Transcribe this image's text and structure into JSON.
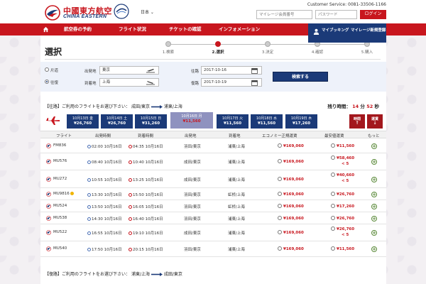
{
  "header": {
    "logo_cn": "中國東方航空",
    "logo_en": "CHINA EASTERN",
    "language": "日本 ⌄",
    "service": "Customer Service: 0081-33506-1166",
    "member_placeholder": "マイレージ会員番号",
    "password_placeholder": "パスワード",
    "login_label": "ログイン"
  },
  "nav": {
    "items": [
      "航空券の予約",
      "フライト状況",
      "チケットの確認",
      "インフォメーション"
    ],
    "mybooking": "マイブッキング",
    "mileage_signup": "マイレージ新規登録"
  },
  "page": {
    "title": "選択",
    "steps": [
      "1.検索",
      "2.選択",
      "3.決定",
      "4.確認",
      "5.購入"
    ],
    "active_step": 1
  },
  "search": {
    "oneway_label": "片道",
    "roundtrip_label": "往復",
    "depart_label": "出発地",
    "depart_value": "東京",
    "arrive_label": "到着地",
    "arrive_value": "上海",
    "outbound_label": "往路",
    "outbound_date": "2017-10-16",
    "return_label": "復路",
    "return_date": "2017-10-19",
    "search_label": "検索する"
  },
  "outbound": {
    "prefix": "【往路】ご利用のフライトをお選び下さい：",
    "from": "成田/東京",
    "to": "浦東/上海",
    "remaining_label": "残り時間：",
    "remaining_min": "14",
    "min_unit": "分",
    "remaining_sec": "52",
    "sec_unit": "秒"
  },
  "date_tabs": [
    {
      "date": "10月13日 金",
      "price": "¥26,760",
      "selected": false
    },
    {
      "date": "10月14日 土",
      "price": "¥26,760",
      "selected": false
    },
    {
      "date": "10月15日 日",
      "price": "¥31,260",
      "selected": false
    },
    {
      "date": "10月16日 月",
      "price": "¥11,560",
      "selected": true
    },
    {
      "date": "10月17日 火",
      "price": "¥11,560",
      "selected": false
    },
    {
      "date": "10月18日 水",
      "price": "¥11,560",
      "selected": false
    },
    {
      "date": "10月19日 木",
      "price": "¥17,260",
      "selected": false
    }
  ],
  "sort": [
    {
      "label": "時間",
      "arrow": "↑"
    },
    {
      "label": "運賃",
      "arrow": "↓"
    }
  ],
  "table": {
    "headers": [
      "フライト",
      "出発時間",
      "到着時間",
      "出発地",
      "到着地",
      "エコノミー正規運賃",
      "最安値運賃",
      "もっと"
    ],
    "rows": [
      {
        "flight": "FM836",
        "dep": "02:00 10月16日",
        "arr": "04:35 10月16日",
        "from": "羽田/東京",
        "to": "浦東/上海",
        "fare": "¥169,060",
        "low": "¥11,560",
        "low_sub": ""
      },
      {
        "flight": "MU576",
        "dep": "08:40 10月16日",
        "arr": "10:40 10月16日",
        "from": "成田/東京",
        "to": "浦東/上海",
        "fare": "¥169,060",
        "low": "¥58,460",
        "low_sub": "< 5"
      },
      {
        "flight": "MU272",
        "dep": "10:55 10月16日",
        "arr": "13:25 10月16日",
        "from": "成田/東京",
        "to": "浦東/上海",
        "fare": "¥169,060",
        "low": "¥40,660",
        "low_sub": "< 5"
      },
      {
        "flight": "MU9816",
        "dep": "13:30 10月16日",
        "arr": "15:50 10月16日",
        "from": "羽田/東京",
        "to": "虹桥/上海",
        "fare": "¥169,060",
        "low": "¥26,760",
        "low_sub": "",
        "coin": true
      },
      {
        "flight": "MU524",
        "dep": "13:50 10月16日",
        "arr": "16:05 10月16日",
        "from": "羽田/東京",
        "to": "虹桥/上海",
        "fare": "¥169,060",
        "low": "¥17,260",
        "low_sub": ""
      },
      {
        "flight": "MU538",
        "dep": "14:30 10月16日",
        "arr": "16:40 10月16日",
        "from": "羽田/東京",
        "to": "浦東/上海",
        "fare": "¥169,060",
        "low": "¥26,760",
        "low_sub": ""
      },
      {
        "flight": "MU522",
        "dep": "16:55 10月16日",
        "arr": "19:10 10月16日",
        "from": "成田/東京",
        "to": "浦東/上海",
        "fare": "¥169,060",
        "low": "¥26,760",
        "low_sub": "< 5"
      },
      {
        "flight": "MU540",
        "dep": "17:50 10月16日",
        "arr": "20:15 10月16日",
        "from": "羽田/東京",
        "to": "浦東/上海",
        "fare": "¥169,060",
        "low": "¥11,560",
        "low_sub": ""
      }
    ]
  },
  "return_section": {
    "prefix": "【復路】ご利用のフライトをお選び下さい：",
    "from": "浦東/上海",
    "to": "成田/東京"
  },
  "colors": {
    "brand_red": "#c8161e",
    "brand_navy": "#1b3a78",
    "selected_tab": "#8f92bf"
  }
}
